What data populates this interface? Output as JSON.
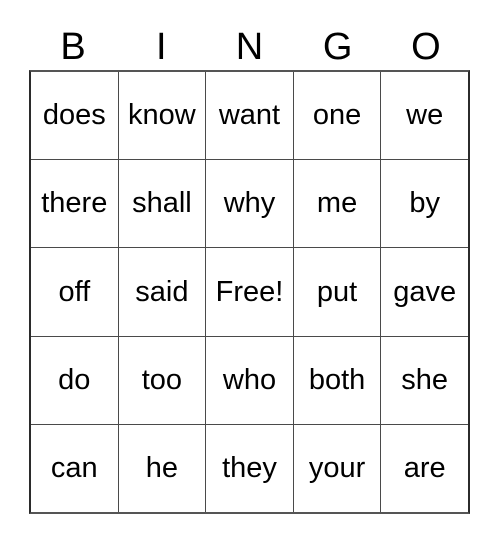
{
  "card": {
    "header_letters": [
      "B",
      "I",
      "N",
      "G",
      "O"
    ],
    "rows": [
      {
        "cells": [
          "does",
          "know",
          "want",
          "one",
          "we"
        ]
      },
      {
        "cells": [
          "there",
          "shall",
          "why",
          "me",
          "by"
        ]
      },
      {
        "cells": [
          "off",
          "said",
          "Free!",
          "put",
          "gave"
        ]
      },
      {
        "cells": [
          "do",
          "too",
          "who",
          "both",
          "she"
        ]
      },
      {
        "cells": [
          "can",
          "he",
          "they",
          "your",
          "are"
        ]
      }
    ],
    "colors": {
      "background": "#ffffff",
      "text": "#000000",
      "grid_line": "#4a4a4a",
      "grid_outer_border": "#2b2b2b"
    }
  }
}
